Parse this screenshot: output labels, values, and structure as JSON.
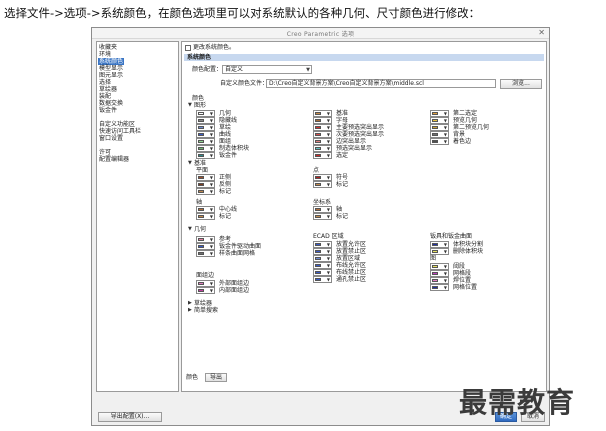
{
  "intro": "选择文件->选项->系统颜色，在颜色选项里可以对系统默认的各种几何、尺寸颜色进行修改：",
  "dialog": {
    "title": "Creo Parametric 选项",
    "close_icon": "close-icon"
  },
  "nav": {
    "items": [
      {
        "label": "收藏夹",
        "selected": false
      },
      {
        "label": "环境",
        "selected": false
      },
      {
        "label": "系统颜色",
        "selected": true
      },
      {
        "label": "模型显示",
        "selected": false
      },
      {
        "label": "图元显示",
        "selected": false
      },
      {
        "label": "选择",
        "selected": false
      },
      {
        "label": "草绘器",
        "selected": false
      },
      {
        "label": "装配",
        "selected": false
      },
      {
        "label": "数据交换",
        "selected": false
      },
      {
        "label": "钣金件",
        "selected": false
      },
      {
        "label": "自定义功能区",
        "selected": false
      },
      {
        "label": "快速访问工具栏",
        "selected": false
      },
      {
        "label": "窗口设置",
        "selected": false
      },
      {
        "label": "许可",
        "selected": false
      },
      {
        "label": "配置编辑器",
        "selected": false
      }
    ]
  },
  "main": {
    "change_system_colors": "更改系统颜色。",
    "section_header": "系统颜色",
    "color_config_label": "颜色配置：",
    "color_config_value": "自定义",
    "custom_file_label": "自定义颜色文件：",
    "custom_file_value": "D:\\Creo自定义背景方案\\Creo自定义背景方案\\middle.scl",
    "browse": "浏览...",
    "colors_heading": "颜色",
    "groups": {
      "graphics": "图形",
      "datum": "基准",
      "plane": "平面",
      "point": "点",
      "axis": "轴",
      "csys": "坐标系",
      "geometry": "几何",
      "ecad": "ECAD 区域",
      "sheetmetal_curves": "钣具和钣金曲面",
      "surface_edge": "面组边",
      "hole": "图",
      "sketcher": "草绘器",
      "simple_search": "简单搜索"
    },
    "graphics_items": [
      {
        "label": "几何",
        "color": "#ffffff"
      },
      {
        "label": "隐藏线",
        "color": "#8a8a8a"
      },
      {
        "label": "草绘",
        "color": "#6f8ccf"
      },
      {
        "label": "曲线",
        "color": "#3a5bc4"
      },
      {
        "label": "面组",
        "color": "#92d692"
      },
      {
        "label": "制造体积块",
        "color": "#6fb66f"
      },
      {
        "label": "钣金件",
        "color": "#2f8a8a"
      },
      {
        "label": "基准",
        "color": "#c48a4a"
      },
      {
        "label": "字母",
        "color": "#a06a3a"
      },
      {
        "label": "主要预选突出显示",
        "color": "#d03030"
      },
      {
        "label": "次要预选突出显示",
        "color": "#d05050"
      },
      {
        "label": "边突出显示",
        "color": "#e08080"
      },
      {
        "label": "预选突出显示",
        "color": "#60c0c0"
      },
      {
        "label": "选定",
        "color": "#c82828"
      },
      {
        "label": "第二选定",
        "color": "#e0a040"
      },
      {
        "label": "预览几何",
        "color": "#e6c040"
      },
      {
        "label": "第二预览几何",
        "color": "#c8a038"
      },
      {
        "label": "背景",
        "color": "#707070"
      },
      {
        "label": "着色边",
        "color": "#505050"
      }
    ],
    "plane_items": [
      {
        "label": "正侧",
        "color": "#a0522d"
      },
      {
        "label": "反侧",
        "color": "#7a3c20"
      },
      {
        "label": "标记",
        "color": "#c08a50"
      }
    ],
    "point_items": [
      {
        "label": "符号",
        "color": "#b02020"
      },
      {
        "label": "标记",
        "color": "#c08a50"
      }
    ],
    "axis_items": [
      {
        "label": "中心线",
        "color": "#b07040"
      },
      {
        "label": "标记",
        "color": "#c08a50"
      }
    ],
    "csys_items": [
      {
        "label": "轴",
        "color": "#b07040"
      },
      {
        "label": "标记",
        "color": "#c08a50"
      }
    ],
    "geometry_items": [
      {
        "label": "参考",
        "color": "#e080a0"
      },
      {
        "label": "钣金件驱动曲面",
        "color": "#3a5bc4"
      },
      {
        "label": "样条曲面网格",
        "color": "#707070"
      }
    ],
    "ecad_items": [
      {
        "label": "放置允许区",
        "color": "#3a5bc4"
      },
      {
        "label": "放置禁止区",
        "color": "#3a5bc4"
      },
      {
        "label": "放置区域",
        "color": "#6f8ccf"
      },
      {
        "label": "布线允许区",
        "color": "#3a5bc4"
      },
      {
        "label": "布线禁止区",
        "color": "#3a5bc4"
      },
      {
        "label": "通孔禁止区",
        "color": "#3a5bc4"
      }
    ],
    "sheetmetal_items": [
      {
        "label": "体积块分割",
        "color": "#2030a0"
      },
      {
        "label": "删除体积块",
        "color": "#e6e060"
      }
    ],
    "surface_edge_items": [
      {
        "label": "外部面组边",
        "color": "#e080c0"
      },
      {
        "label": "内部面组边",
        "color": "#c040a0"
      }
    ],
    "hole_items": [
      {
        "label": "阈段",
        "color": "#e6e060"
      },
      {
        "label": "网格段",
        "color": "#c040c0"
      },
      {
        "label": "焊位置",
        "color": "#e080c0"
      },
      {
        "label": "网格位置",
        "color": "#2030a0"
      }
    ],
    "bottom_label": "颜色",
    "export": "导出"
  },
  "footer": {
    "export_config": "导出配置(X)...",
    "ok": "确定",
    "cancel": "取消"
  },
  "watermark": "最需教育"
}
